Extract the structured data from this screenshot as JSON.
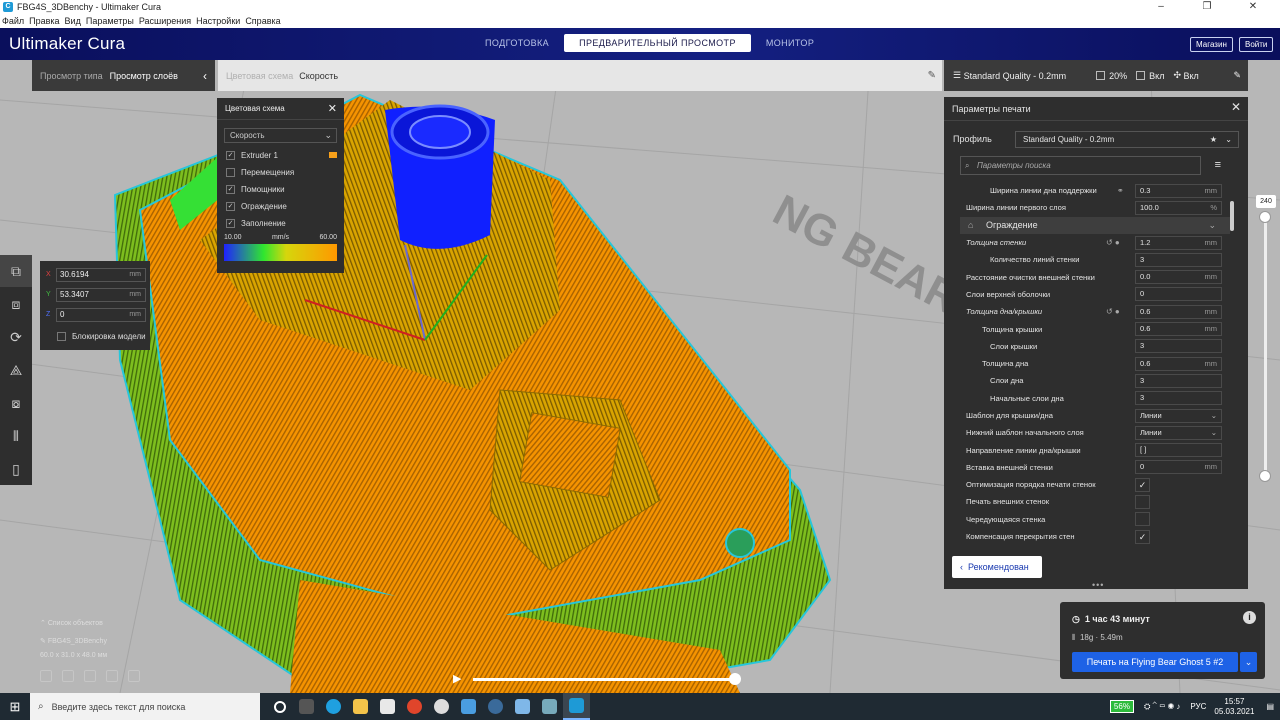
{
  "window": {
    "title": "FBG4S_3DBenchy - Ultimaker Cura",
    "controls": [
      "–",
      "❐",
      "✕"
    ]
  },
  "menu": [
    "Файл",
    "Правка",
    "Вид",
    "Параметры",
    "Расширения",
    "Настройки",
    "Справка"
  ],
  "header": {
    "logo_light": "Ultimaker",
    "logo_bold": "Cura",
    "stages": [
      "ПОДГОТОВКА",
      "ПРЕДВАРИТЕЛЬНЫЙ ПРОСМОТР",
      "МОНИТОР"
    ],
    "marketplace": "Магазин",
    "signin": "Войти"
  },
  "viewbar": {
    "type_label": "Просмотр типа",
    "type_value": "Просмотр слоёв"
  },
  "colorbar": {
    "label": "Цветовая схема",
    "value": "Скорость"
  },
  "qualbar": {
    "profile": "Standard Quality - 0.2mm",
    "infill": "20%",
    "support": "Вкл",
    "adhesion": "Вкл"
  },
  "color_scheme_panel": {
    "title": "Цветовая схема",
    "dropdown": "Скорость",
    "items": [
      {
        "label": "Extruder 1",
        "checked": true
      },
      {
        "label": "Перемещения",
        "checked": false
      },
      {
        "label": "Помощники",
        "checked": true
      },
      {
        "label": "Ограждение",
        "checked": true
      },
      {
        "label": "Заполнение",
        "checked": true
      }
    ],
    "range_min": "10.00",
    "range_unit": "mm/s",
    "range_max": "60.00"
  },
  "coords": {
    "x": "30.6194",
    "y": "53.3407",
    "z": "0",
    "unit": "mm",
    "lock_label": "Блокировка модели"
  },
  "object_info": {
    "list": "Список объектов",
    "name": "FBG4S_3DBenchy",
    "dims": "60.0 x 31.0 x 48.0 мм"
  },
  "settings": {
    "title": "Параметры печати",
    "profile_label": "Профиль",
    "profile_value": "Standard Quality - 0.2mm",
    "search_placeholder": "Параметры поиска",
    "rows": [
      {
        "label": "Ширина линии дна поддержки",
        "value": "0.3",
        "unit": "mm",
        "indent": 2,
        "link": true
      },
      {
        "label": "Ширина линии первого слоя",
        "value": "100.0",
        "unit": "%",
        "indent": 0
      },
      {
        "category": "Ограждение"
      },
      {
        "label": "Толщина стенки",
        "value": "1.2",
        "unit": "mm",
        "indent": 0,
        "italic": true,
        "reset": true
      },
      {
        "label": "Количество линий стенки",
        "value": "3",
        "unit": "",
        "indent": 2
      },
      {
        "label": "Расстояние очистки внешней стенки",
        "value": "0.0",
        "unit": "mm",
        "indent": 0
      },
      {
        "label": "Слои верхней оболочки",
        "value": "0",
        "unit": "",
        "indent": 0
      },
      {
        "label": "Толщина дна/крышки",
        "value": "0.6",
        "unit": "mm",
        "indent": 0,
        "italic": true,
        "reset": true
      },
      {
        "label": "Толщина крышки",
        "value": "0.6",
        "unit": "mm",
        "indent": 1
      },
      {
        "label": "Слои крышки",
        "value": "3",
        "unit": "",
        "indent": 2
      },
      {
        "label": "Толщина дна",
        "value": "0.6",
        "unit": "mm",
        "indent": 1
      },
      {
        "label": "Слои дна",
        "value": "3",
        "unit": "",
        "indent": 2
      },
      {
        "label": "Начальные слои дна",
        "value": "3",
        "unit": "",
        "indent": 2
      },
      {
        "label": "Шаблон для крышки/дна",
        "value": "Линии",
        "dropdown": true,
        "indent": 0
      },
      {
        "label": "Нижний шаблон начального слоя",
        "value": "Линии",
        "dropdown": true,
        "indent": 0
      },
      {
        "label": "Направление линии дна/крышки",
        "value": "[ ]",
        "unit": "",
        "indent": 0
      },
      {
        "label": "Вставка внешней стенки",
        "value": "0",
        "unit": "mm",
        "indent": 0
      },
      {
        "label": "Оптимизация порядка печати стенок",
        "checkbox": true,
        "checked": true,
        "indent": 0
      },
      {
        "label": "Печать внешних стенок",
        "checkbox": true,
        "checked": false,
        "indent": 0
      },
      {
        "label": "Чередующаяся стенка",
        "checkbox": true,
        "checked": false,
        "indent": 0
      },
      {
        "label": "Компенсация перекрытия стен",
        "checkbox": true,
        "checked": true,
        "indent": 0
      }
    ],
    "recommended_button": "Рекомендован"
  },
  "layer_slider": {
    "value": "240"
  },
  "action_panel": {
    "time": "1 час 43 минут",
    "material": "18g · 5.49m",
    "print_button": "Печать на Flying Bear Ghost 5 #2"
  },
  "taskbar": {
    "search_placeholder": "Введите здесь текст для поиска",
    "battery": "56%",
    "lang": "РУС",
    "time": "15:57",
    "date": "05.03.2021"
  },
  "colors": {
    "header_bg": "#142082",
    "print_button": "#1e62e6",
    "slow_speed": "#1f22ff",
    "mid_speed": "#2fe62f",
    "fast_speed": "#ff9800"
  }
}
